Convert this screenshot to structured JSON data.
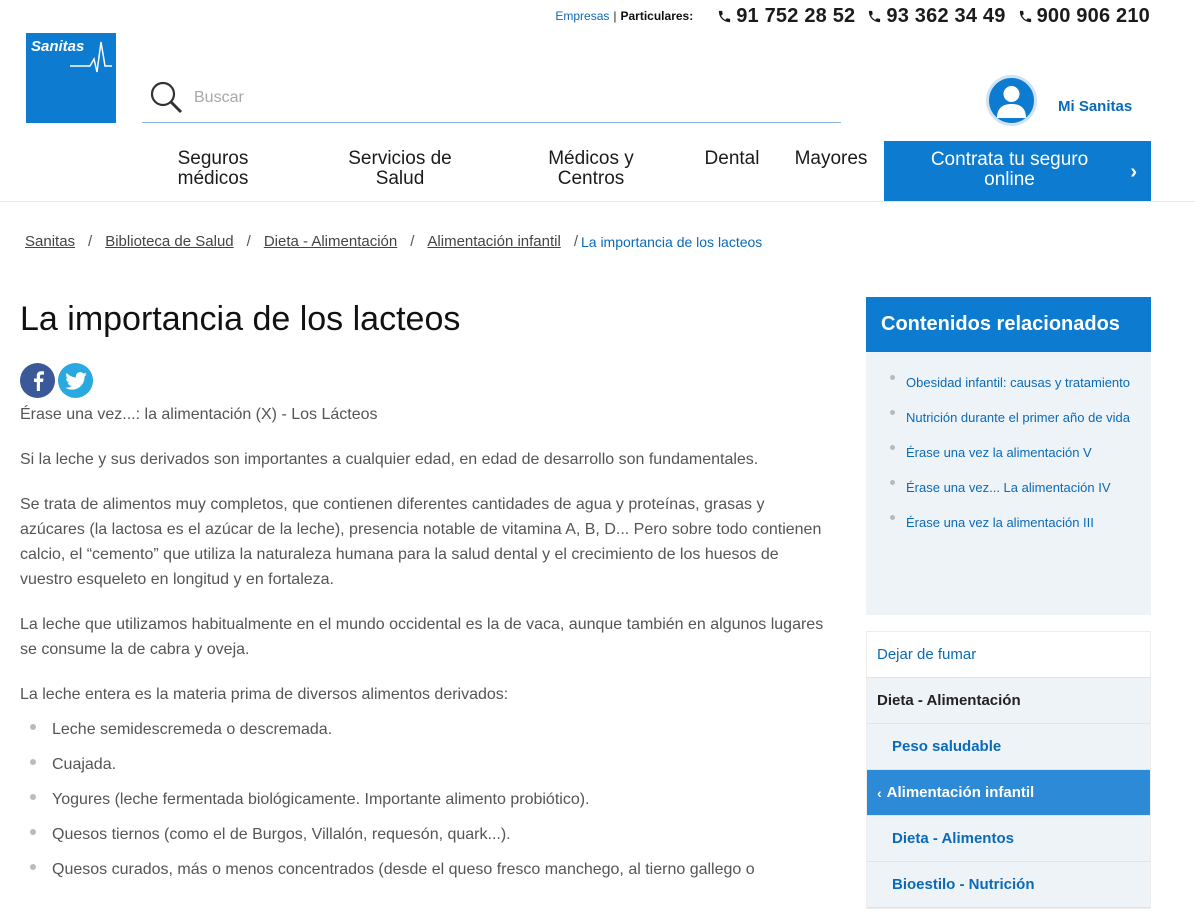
{
  "topbar": {
    "empresas": "Empresas",
    "separator": "|",
    "particulares": "Particulares:",
    "phones": [
      "91 752 28 52",
      "93 362 34 49",
      "900 906 210"
    ]
  },
  "logo": {
    "text": "Sanitas",
    "icon": "heartbeat-icon",
    "color": "#0c7bd0"
  },
  "search": {
    "placeholder": "Buscar",
    "value": "",
    "icon": "search-icon"
  },
  "account": {
    "label": "Mi Sanitas",
    "icon": "user-icon"
  },
  "nav": {
    "items": [
      {
        "label": "Seguros\nmédicos"
      },
      {
        "label": "Servicios de\nSalud"
      },
      {
        "label": "Médicos y\nCentros"
      },
      {
        "label": "Dental"
      },
      {
        "label": "Mayores"
      }
    ],
    "cta": {
      "label": "Contrata tu seguro\nonline",
      "icon": "chevron-right-icon"
    }
  },
  "breadcrumb": {
    "items": [
      "Sanitas",
      "Biblioteca de Salud",
      "Dieta - Alimentación",
      "Alimentación infantil"
    ],
    "separator": "/",
    "current": "La importancia de los lacteos"
  },
  "article": {
    "title": "La importancia de los lacteos",
    "share": [
      "facebook-icon",
      "twitter-icon"
    ],
    "subtitle": "Érase una vez...: la alimentación (X) - Los Lácteos",
    "paragraphs": [
      "Si la leche y sus derivados son importantes a cualquier edad, en edad de desarrollo son fundamentales.",
      "Se trata de alimentos muy completos, que contienen diferentes cantidades de agua y proteínas, grasas y azúcares (la lactosa es el azúcar de la leche), presencia notable de vitamina A, B, D... Pero sobre todo contienen calcio, el “cemento” que utiliza la naturaleza humana para la salud dental y el crecimiento de los huesos de vuestro esqueleto en longitud y en fortaleza.",
      "La leche que utilizamos habitualmente en el mundo occidental es la de vaca, aunque también en algunos lugares se consume la de cabra y oveja.",
      "La leche entera es la materia prima de diversos alimentos derivados:"
    ],
    "list": [
      "Leche semidescremeda o descremada.",
      "Cuajada.",
      "Yogures (leche fermentada biológicamente. Importante alimento probiótico).",
      "Quesos tiernos (como el de Burgos, Villalón, requesón, quark...).",
      "Quesos curados, más o menos concentrados (desde el queso fresco manchego, al tierno gallego o"
    ]
  },
  "related": {
    "title": "Contenidos relacionados",
    "items": [
      "Obesidad infantil: causas y tratamiento",
      "Nutrición durante el primer año de vida",
      "Érase una vez la alimentación V",
      "Érase una vez... La alimentación IV",
      "Érase una vez la alimentación III"
    ]
  },
  "sidenav": {
    "items": [
      {
        "label": "Dejar de fumar"
      },
      {
        "label": "Dieta - Alimentación"
      },
      {
        "label": "Peso saludable"
      },
      {
        "label": "Alimentación infantil"
      },
      {
        "label": "Dieta - Alimentos"
      },
      {
        "label": "Bioestilo - Nutrición"
      }
    ]
  }
}
